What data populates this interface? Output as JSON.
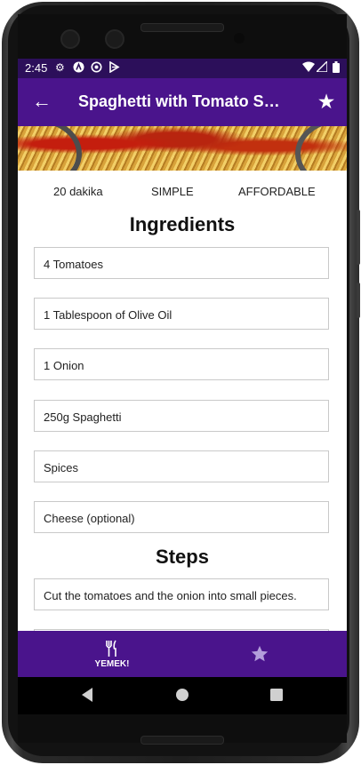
{
  "status_bar": {
    "time": "2:45",
    "icons": [
      "gear-icon",
      "android-auto-icon",
      "vpn-key-icon",
      "play-protect-icon"
    ],
    "right_icons": [
      "wifi-icon",
      "cellular-signal-icon",
      "battery-icon"
    ]
  },
  "app_bar": {
    "title": "Spaghetti with Tomato Sauce",
    "back_icon": "back-arrow-icon",
    "favorite_icon": "star-icon"
  },
  "meal": {
    "duration": "20 dakika",
    "complexity": "SIMPLE",
    "affordability": "AFFORDABLE"
  },
  "ingredients": {
    "title": "Ingredients",
    "items": [
      "4 Tomatoes",
      "1 Tablespoon of Olive Oil",
      "1 Onion",
      "250g Spaghetti",
      "Spices",
      "Cheese (optional)"
    ]
  },
  "steps": {
    "title": "Steps",
    "items": [
      "Cut the tomatoes and the onion into small pieces.",
      ""
    ]
  },
  "bottom_nav": {
    "items": [
      {
        "label": "YEMEK!",
        "icon": "restaurant-icon",
        "selected": true
      },
      {
        "label": "",
        "icon": "star-icon",
        "selected": false
      }
    ]
  },
  "colors": {
    "primary": "#4a148c",
    "status_bar": "#2c0f5a",
    "inactive_nav_icon": "#b39ddb"
  }
}
